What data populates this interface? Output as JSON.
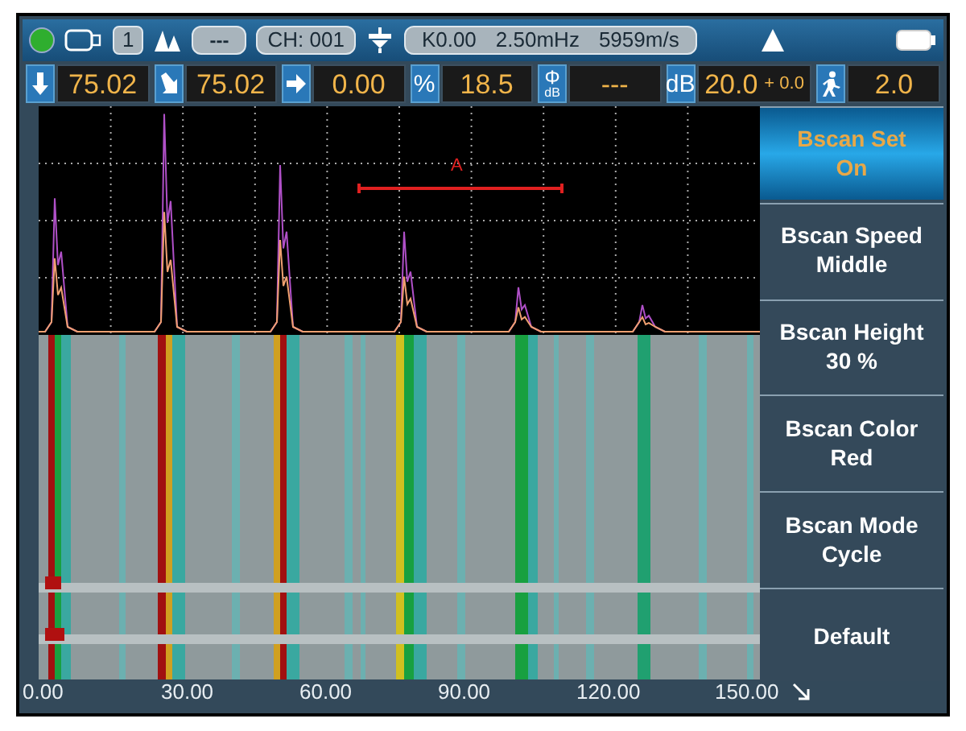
{
  "status_bar": {
    "led": {
      "color": "#2fae2f"
    },
    "probe_number": "1",
    "mode_value": "---",
    "channel": "CH: 001",
    "probe_params": [
      "K0.00",
      "2.50mHz",
      "5959m/s"
    ]
  },
  "readings": [
    {
      "kind": "down-arrow",
      "value": "75.02"
    },
    {
      "kind": "diagonal-arrow",
      "value": "75.02"
    },
    {
      "kind": "right-arrow",
      "value": "0.00"
    },
    {
      "kind": "label",
      "label": "%",
      "value": "18.5"
    },
    {
      "kind": "stack",
      "label": "Φ",
      "sublabel": "dB",
      "value": "---"
    },
    {
      "kind": "label",
      "label": "dB",
      "value": "20.0",
      "suffix": "+ 0.0"
    },
    {
      "kind": "walker",
      "value": "2.0"
    }
  ],
  "plot": {
    "gate_label": "A"
  },
  "axis_labels": [
    "0.00",
    "30.00",
    "60.00",
    "90.00",
    "120.00",
    "150.00"
  ],
  "menu": [
    {
      "lines": [
        "Bscan Set",
        "On"
      ],
      "selected": true
    },
    {
      "lines": [
        "Bscan Speed",
        "Middle"
      ],
      "selected": false
    },
    {
      "lines": [
        "Bscan Height",
        "30 %"
      ],
      "selected": false
    },
    {
      "lines": [
        "Bscan Color",
        "Red"
      ],
      "selected": false
    },
    {
      "lines": [
        "Bscan Mode",
        "Cycle"
      ],
      "selected": false
    },
    {
      "lines": [
        "Default"
      ],
      "selected": false
    }
  ]
}
